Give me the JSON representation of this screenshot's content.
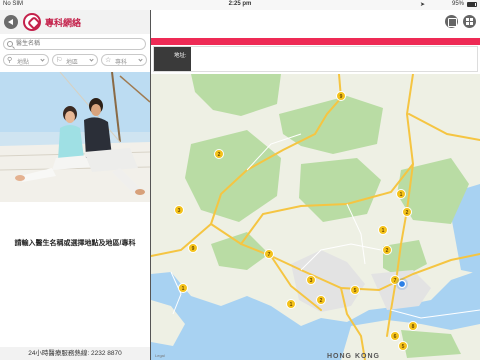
{
  "status_bar": {
    "carrier": "No SIM",
    "time": "2:25 pm",
    "battery": "95%"
  },
  "header": {
    "title": "專科網絡"
  },
  "search": {
    "placeholder": "醫生名稱"
  },
  "filters": [
    {
      "label": "地點",
      "icon": "map-pin-icon"
    },
    {
      "label": "地區",
      "icon": "tag-icon"
    },
    {
      "label": "專科",
      "icon": "star-icon"
    }
  ],
  "main": {
    "instruction": "請輸入醫生名稱或選擇地點及地區/專科",
    "hotline": "24小時醫療服務熱線: 2232 8870"
  },
  "detail": {
    "address_label": "地址:"
  },
  "map": {
    "city_label": "HONG KONG",
    "legal_label": "Legal",
    "markers": [
      "9",
      "2",
      "1",
      "2",
      "3",
      "9",
      "1",
      "7",
      "1",
      "2",
      "5",
      "3",
      "7",
      "2",
      "1",
      "8",
      "6",
      "5"
    ],
    "colors": {
      "marker": "#f4c21a",
      "land": "#eef0e4",
      "park": "#b9dca4",
      "water": "#a8d2f2",
      "accent": "#ee2a55",
      "brand": "#c4214b",
      "location_dot": "#2b7fe6"
    }
  }
}
